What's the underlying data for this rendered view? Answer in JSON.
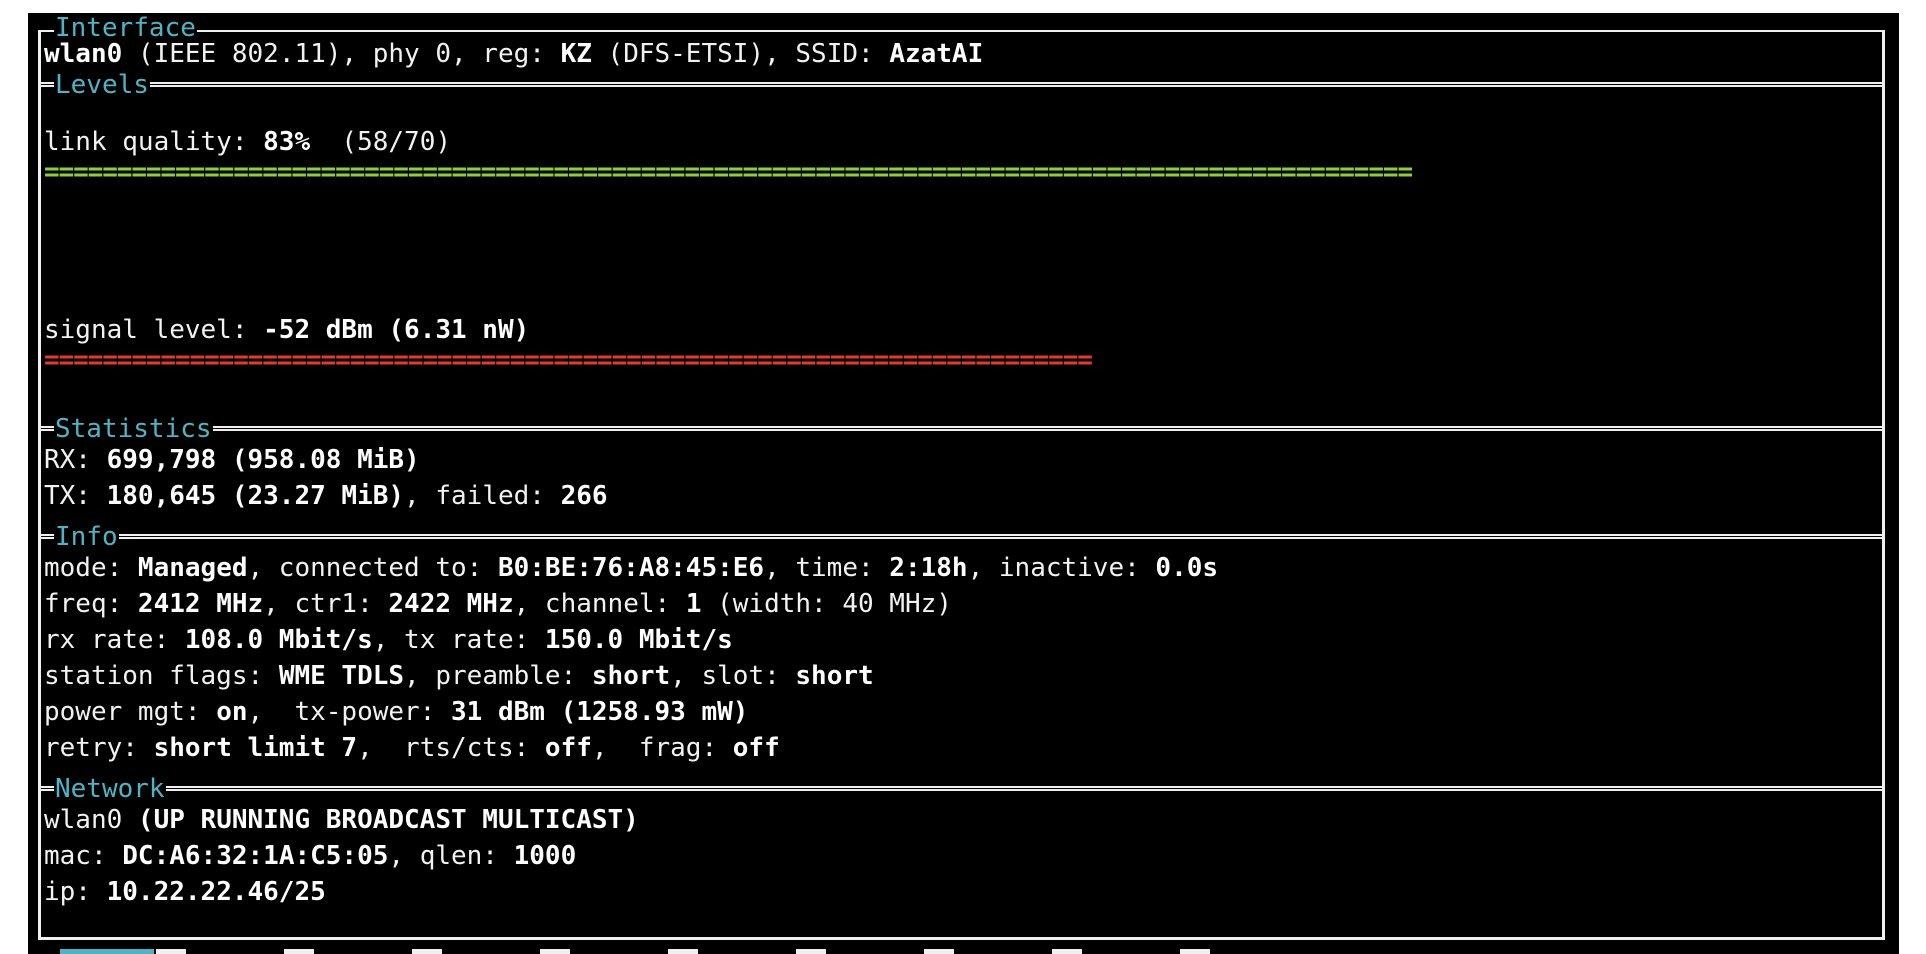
{
  "sections": {
    "interface": "Interface",
    "levels": "Levels",
    "statistics": "Statistics",
    "info": "Info",
    "network": "Network"
  },
  "interface": {
    "l1": "wlan0",
    "l2": " (IEEE 802.11), phy 0, reg: ",
    "l3": "KZ",
    "l4": " (DFS-ETSI), SSID: ",
    "l5": "AzatAI"
  },
  "levels": {
    "link_label": "link quality: ",
    "link_value": "83%",
    "link_ratio": "  (58/70)",
    "link_fraction": 0.83,
    "signal_label": "signal level: ",
    "signal_value": "-52 dBm (6.31 nW)",
    "signal_fraction": 0.64,
    "bar_color_link": "#8bd039",
    "bar_color_signal": "#e23a33"
  },
  "statistics": {
    "rx_label": "RX: ",
    "rx_value": "699,798 (958.08 MiB)",
    "tx_label": "TX: ",
    "tx_value": "180,645 (23.27 MiB)",
    "tx_failed_label": ", failed: ",
    "tx_failed_value": "266"
  },
  "info": {
    "mode_label": "mode: ",
    "mode_value": "Managed",
    "connected_label": ", connected to: ",
    "connected_value": "B0:BE:76:A8:45:E6",
    "time_label": ", time: ",
    "time_value": "2:18h",
    "inactive_label": ", inactive: ",
    "inactive_value": "0.0s",
    "freq_label": "freq: ",
    "freq_value": "2412 MHz",
    "ctr1_label": ", ctr1: ",
    "ctr1_value": "2422 MHz",
    "channel_label": ", channel: ",
    "channel_value": "1",
    "width_text": " (width: 40 MHz)",
    "rx_rate_label": "rx rate: ",
    "rx_rate_value": "108.0 Mbit/s",
    "tx_rate_label": ", tx rate: ",
    "tx_rate_value": "150.0 Mbit/s",
    "flags_label": "station flags: ",
    "flags_value": "WME TDLS",
    "preamble_label": ", preamble: ",
    "preamble_value": "short",
    "slot_label": ", slot: ",
    "slot_value": "short",
    "power_label": "power mgt: ",
    "power_value": "on",
    "txpower_label": ",  tx-power: ",
    "txpower_value": "31 dBm (1258.93 mW)",
    "retry_label": "retry: ",
    "retry_value": "short limit 7",
    "rts_label": ",  rts/cts: ",
    "rts_value": "off",
    "frag_label": ",  frag: ",
    "frag_value": "off"
  },
  "network": {
    "iface": "wlan0 ",
    "flags": "(UP RUNNING BROADCAST MULTICAST)",
    "mac_label": "mac: ",
    "mac_value": "DC:A6:32:1A:C5:05",
    "qlen_label": ", qlen: ",
    "qlen_value": "1000",
    "ip_label": "ip: ",
    "ip_value": "10.22.22.46/25"
  },
  "colors": {
    "section_title": "#4fb3c4",
    "background": "#000000",
    "text": "#f2f2f2"
  }
}
